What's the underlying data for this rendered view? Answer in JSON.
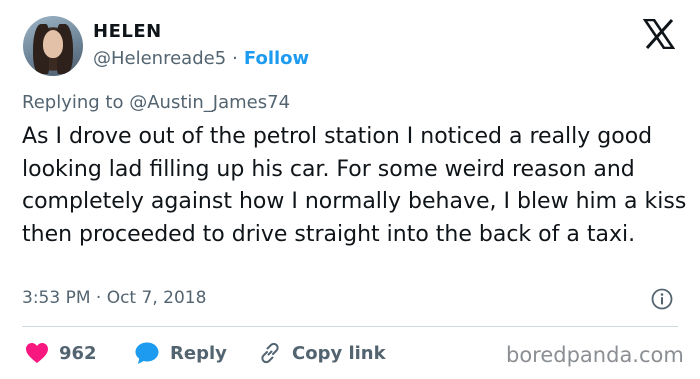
{
  "author": {
    "name": "HELEN",
    "handle": "@Helenreade5",
    "separator": "·",
    "follow_label": "Follow"
  },
  "platform_icon": "x-logo-icon",
  "reply_context": {
    "prefix": "Replying to",
    "mention": "@Austin_James74"
  },
  "tweet": {
    "text": "As I drove out of the petrol station I noticed a really good looking lad filling up his car. For some weird reason and completely against how I normally behave, I blew him a kiss then proceeded to drive straight into the back of a taxi.",
    "timestamp": "3:53 PM · Oct 7, 2018"
  },
  "actions": {
    "like_count": "962",
    "reply_label": "Reply",
    "copy_label": "Copy link"
  },
  "watermark": "boredpanda.com",
  "colors": {
    "like": "#f91880",
    "reply": "#1d9bf0",
    "follow": "#1d9bf0",
    "secondary_text": "#536471"
  }
}
